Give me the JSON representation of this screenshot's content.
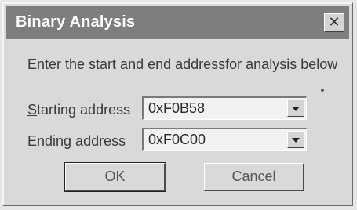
{
  "window": {
    "title": "Binary Analysis",
    "close_label": "✕"
  },
  "instruction": "Enter the start and end addressfor analysis below",
  "fields": {
    "start": {
      "label_accel": "S",
      "label_rest": "tarting address",
      "value": "0xF0B58"
    },
    "end": {
      "label_accel": "E",
      "label_rest": "nding address",
      "value": "0xF0C00"
    }
  },
  "buttons": {
    "ok": "OK",
    "cancel": "Cancel"
  },
  "icons": {
    "close": "close-icon",
    "dropdown": "chevron-down-icon"
  }
}
